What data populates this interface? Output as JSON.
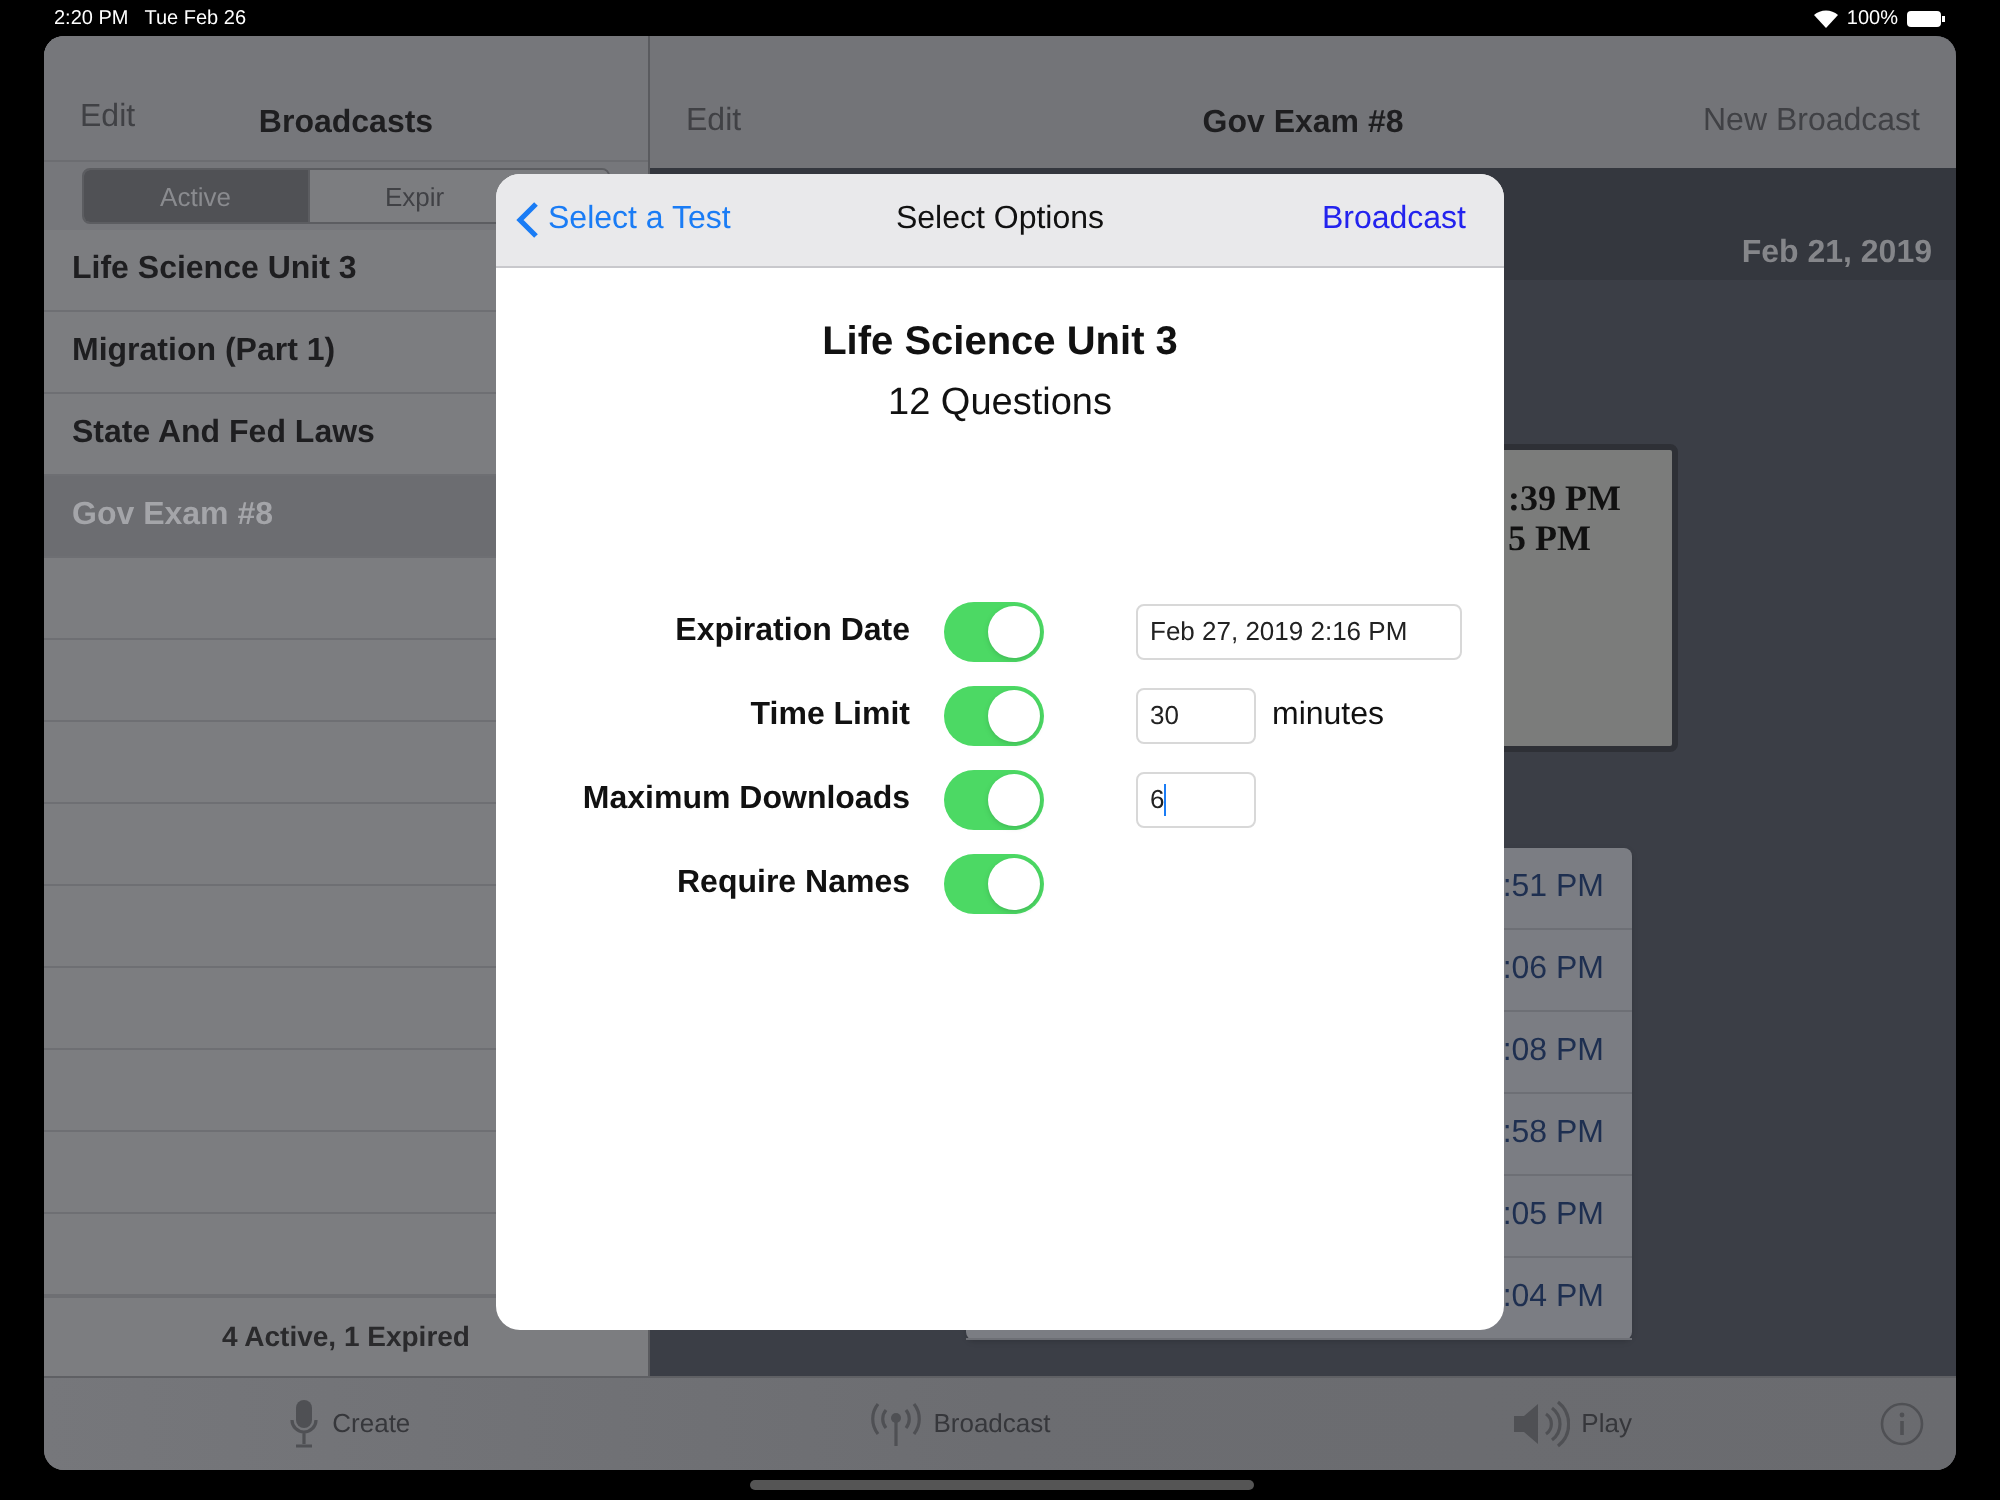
{
  "status_bar": {
    "time": "2:20 PM",
    "date": "Tue Feb 26",
    "battery": "100%"
  },
  "left_nav": {
    "edit": "Edit",
    "title": "Broadcasts"
  },
  "segments": [
    {
      "label": "Active",
      "selected": true
    },
    {
      "label": "Expir",
      "selected": false
    }
  ],
  "broadcasts": [
    {
      "name": "Life Science Unit 3",
      "selected": false
    },
    {
      "name": "Migration (Part 1)",
      "selected": false
    },
    {
      "name": "State And Fed Laws",
      "selected": false
    },
    {
      "name": "Gov Exam #8",
      "selected": true
    }
  ],
  "list_footer": "4 Active, 1 Expired",
  "right_nav": {
    "edit": "Edit",
    "title": "Gov Exam #8",
    "action": "New Broadcast"
  },
  "date_header": "Feb 21, 2019",
  "card_lines": [
    ":39 PM",
    "5 PM"
  ],
  "times": [
    ":51 PM",
    ":06 PM",
    ":08 PM",
    ":58 PM",
    ":05 PM",
    ":04 PM"
  ],
  "tab_bar": [
    {
      "kind": "mic",
      "label": "Create"
    },
    {
      "kind": "antenna",
      "label": "Broadcast"
    },
    {
      "kind": "speaker",
      "label": "Play"
    },
    {
      "kind": "info"
    }
  ],
  "modal": {
    "back": "Select a Test",
    "title": "Select Options",
    "action": "Broadcast",
    "test_name": "Life Science Unit 3",
    "question_count": "12 Questions",
    "options": [
      {
        "label": "Expiration Date",
        "on": true,
        "kind": "date",
        "value": "Feb 27, 2019 2:16 PM"
      },
      {
        "label": "Time Limit",
        "on": true,
        "kind": "number_unit",
        "value": "30",
        "unit": "minutes"
      },
      {
        "label": "Maximum Downloads",
        "on": true,
        "kind": "number",
        "value": "6"
      },
      {
        "label": "Require Names",
        "on": true,
        "kind": "toggle"
      }
    ]
  }
}
